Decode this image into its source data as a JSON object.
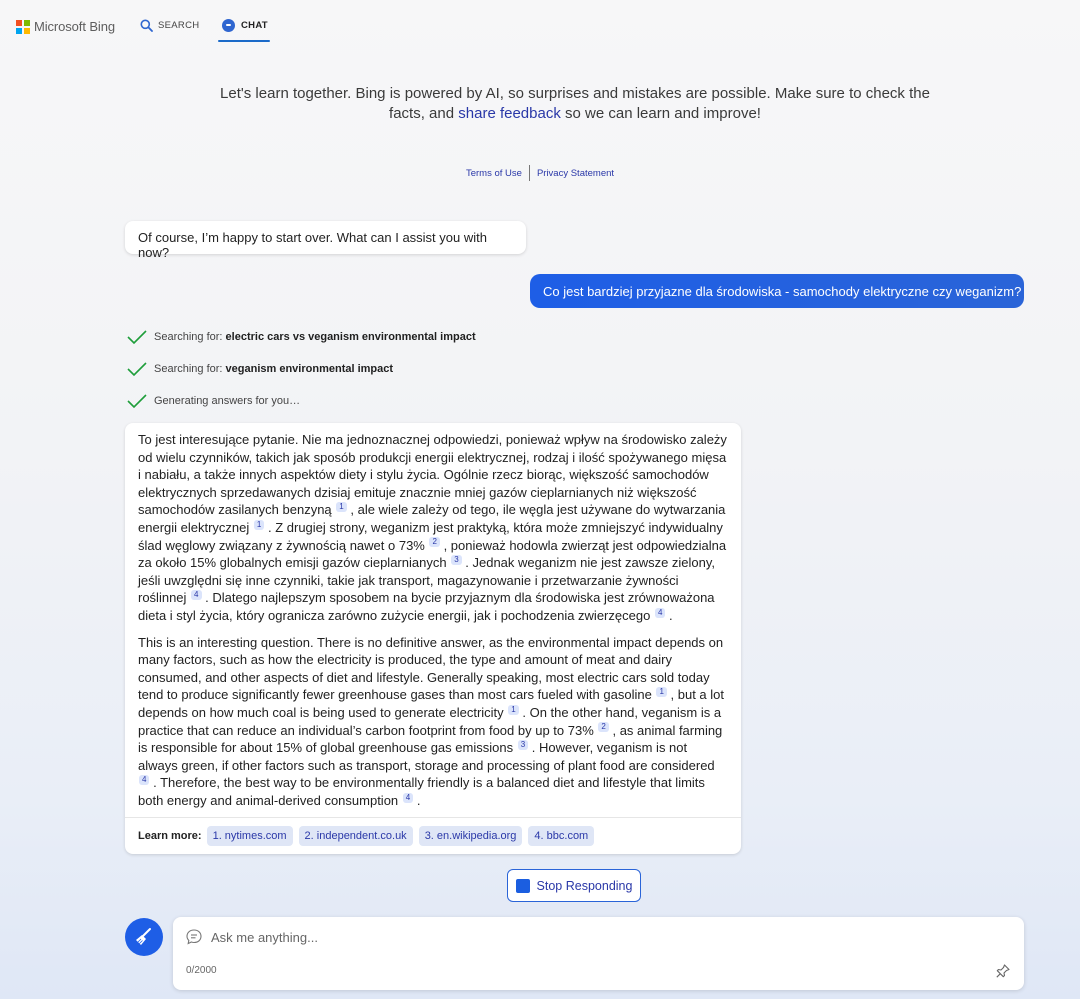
{
  "header": {
    "brand": "Microsoft Bing",
    "nav": {
      "search": "SEARCH",
      "chat": "CHAT"
    },
    "logo_colors": [
      "#f25022",
      "#7fba00",
      "#00a4ef",
      "#ffb900"
    ],
    "icons": {
      "search": "search-icon",
      "chat": "chat-icon"
    }
  },
  "intro": {
    "part1": "Let's learn together. Bing is powered by AI, so surprises and mistakes are possible. Make sure to check the facts, and ",
    "link": "share feedback",
    "part2": " so we can learn and improve!"
  },
  "legal": {
    "terms": "Terms of Use",
    "privacy": "Privacy Statement"
  },
  "messages": {
    "bot_reset": "Of course, I’m happy to start over. What can I assist you with now?",
    "user_question": "Co jest bardziej przyjazne dla środowiska - samochody elektryczne czy weganizm?"
  },
  "progress": [
    {
      "prefix": "Searching for: ",
      "query": "electric cars vs veganism environmental impact"
    },
    {
      "prefix": "Searching for: ",
      "query": "veganism environmental impact"
    },
    {
      "prefix": "Generating answers for you…",
      "query": ""
    }
  ],
  "answer": {
    "pl": {
      "s1": "To jest interesujące pytanie. Nie ma jednoznacznej odpowiedzi, ponieważ wpływ na środowisko zależy od wielu czynników, takich jak sposób produkcji energii elektrycznej, rodzaj i ilość spożywanego mięsa i nabiału, a także innych aspektów diety i stylu życia. Ogólnie rzecz biorąc, większość samochodów elektrycznych sprzedawanych dzisiaj emituje znacznie mniej gazów cieplarnianych niż większość samochodów zasilanych benzyną",
      "s2": ", ale wiele zależy od tego, ile węgla jest używane do wytwarzania energii elektrycznej",
      "s3": ". Z drugiej strony, weganizm jest praktyką, która może zmniejszyć indywidualny ślad węglowy związany z żywnością nawet o 73%",
      "s4": ", ponieważ hodowla zwierząt jest odpowiedzialna za około 15% globalnych emisji gazów cieplarnianych",
      "s5": ". Jednak weganizm nie jest zawsze zielony, jeśli uwzględni się inne czynniki, takie jak transport, magazynowanie i przetwarzanie żywności roślinnej",
      "s6": ". Dlatego najlepszym sposobem na bycie przyjaznym dla środowiska jest zrównoważona dieta i styl życia, który ogranicza zarówno zużycie energii, jak i pochodzenia zwierzęcego",
      "s7": "."
    },
    "en": {
      "s1": "This is an interesting question. There is no definitive answer, as the environmental impact depends on many factors, such as how the electricity is produced, the type and amount of meat and dairy consumed, and other aspects of diet and lifestyle. Generally speaking, most electric cars sold today tend to produce significantly fewer greenhouse gases than most cars fueled with gasoline",
      "s2": ", but a lot depends on how much coal is being used to generate electricity",
      "s3": ". On the other hand, veganism is a practice that can reduce an individual’s carbon footprint from food by up to 73%",
      "s4": ", as animal farming is responsible for about 15% of global greenhouse gas emissions",
      "s5": ". However, veganism is not always green, if other factors such as transport, storage and processing of plant food are considered",
      "s6": ". Therefore, the best way to be environmentally friendly is a balanced diet and lifestyle that limits both energy and animal-derived consumption",
      "s7": "."
    },
    "citations": {
      "c1": "1",
      "c2": "2",
      "c3": "3",
      "c4": "4"
    },
    "learn_more": {
      "title": "Learn more:",
      "links": [
        "1. nytimes.com",
        "2. independent.co.uk",
        "3. en.wikipedia.org",
        "4. bbc.com"
      ]
    }
  },
  "stop_button": "Stop Responding",
  "composer": {
    "placeholder": "Ask me anything...",
    "counter": "0/2000"
  },
  "colors": {
    "accent": "#1e5ee6",
    "link": "#2a38a8",
    "check": "#1e9e3a"
  }
}
